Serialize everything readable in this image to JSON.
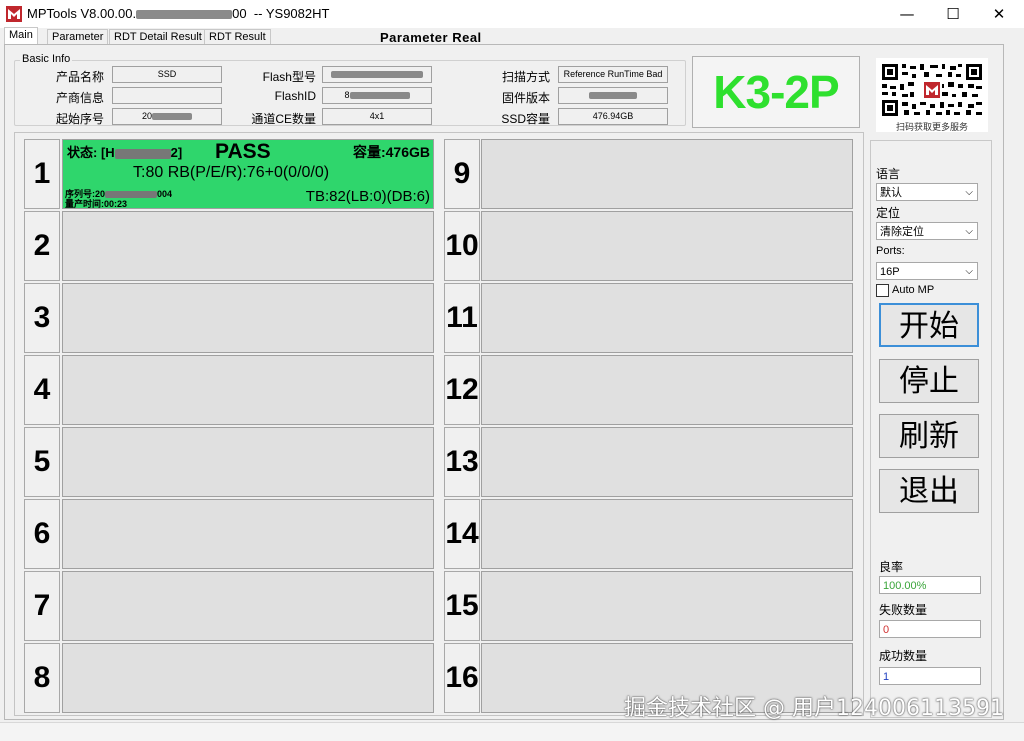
{
  "window": {
    "title_prefix": "MPTools V8.00.00.",
    "title_mid": "00",
    "title_suffix": "-- YS9082HT",
    "minimize": "—",
    "maximize": "☐",
    "close": "✕"
  },
  "tabs": [
    {
      "label": "Main",
      "active": true
    },
    {
      "label": "Parameter",
      "active": false
    },
    {
      "label": "RDT Detail Result",
      "active": false
    },
    {
      "label": "RDT Result",
      "active": false
    }
  ],
  "header_text": "Parameter  Real",
  "basic_info": {
    "title": "Basic Info",
    "product_name_label": "产品名称",
    "product_name_value": "SSD",
    "vendor_label": "产商信息",
    "vendor_value": "",
    "start_serial_label": "起始序号",
    "start_serial_value": "20",
    "flash_type_label": "Flash型号",
    "flash_type_value": "",
    "flash_id_label": "FlashID",
    "flash_id_value": "8",
    "ce_count_label": "通道CE数量",
    "ce_count_value": "4x1",
    "scan_mode_label": "扫描方式",
    "scan_mode_value": "Reference RunTime Bad",
    "firmware_label": "固件版本",
    "firmware_value": "",
    "ssd_capacity_label": "SSD容量",
    "ssd_capacity_value": "476.94GB"
  },
  "model_badge": "K3-2P",
  "qr_caption": "扫码获取更多服务",
  "slots": [
    {
      "num": "1",
      "status": "pass",
      "status_label": "状态: [H",
      "status_end": "2]",
      "result": "PASS",
      "capacity": "容量:476GB",
      "temp_line": "T:80 RB(P/E/R):76+0(0/0/0)",
      "serial": "序列号:20",
      "serial_end": "004",
      "time": "量产时间:00:23",
      "tb_line": "TB:82(LB:0)(DB:6)"
    },
    {
      "num": "2"
    },
    {
      "num": "3"
    },
    {
      "num": "4"
    },
    {
      "num": "5"
    },
    {
      "num": "6"
    },
    {
      "num": "7"
    },
    {
      "num": "8"
    },
    {
      "num": "9"
    },
    {
      "num": "10"
    },
    {
      "num": "11"
    },
    {
      "num": "12"
    },
    {
      "num": "13"
    },
    {
      "num": "14"
    },
    {
      "num": "15"
    },
    {
      "num": "16"
    }
  ],
  "side": {
    "language_label": "语言",
    "language_value": "默认",
    "locate_label": "定位",
    "locate_value": "清除定位",
    "ports_label": "Ports:",
    "ports_value": "16P",
    "auto_mp_label": "Auto MP",
    "auto_mp_checked": false,
    "start_btn": "开始",
    "stop_btn": "停止",
    "refresh_btn": "刷新",
    "exit_btn": "退出",
    "yield_label": "良率",
    "yield_value": "100.00%",
    "fail_label": "失败数量",
    "fail_value": "0",
    "success_label": "成功数量",
    "success_value": "1"
  },
  "colors": {
    "pass_green": "#2fd66c",
    "badge_green": "#2ee02e",
    "yield_green": "#3aa53a",
    "fail_red": "#d03030",
    "success_blue": "#2040c0",
    "focus_blue": "#3c8fd8"
  },
  "watermark": "掘金技术社区 @ 用户124006113591"
}
